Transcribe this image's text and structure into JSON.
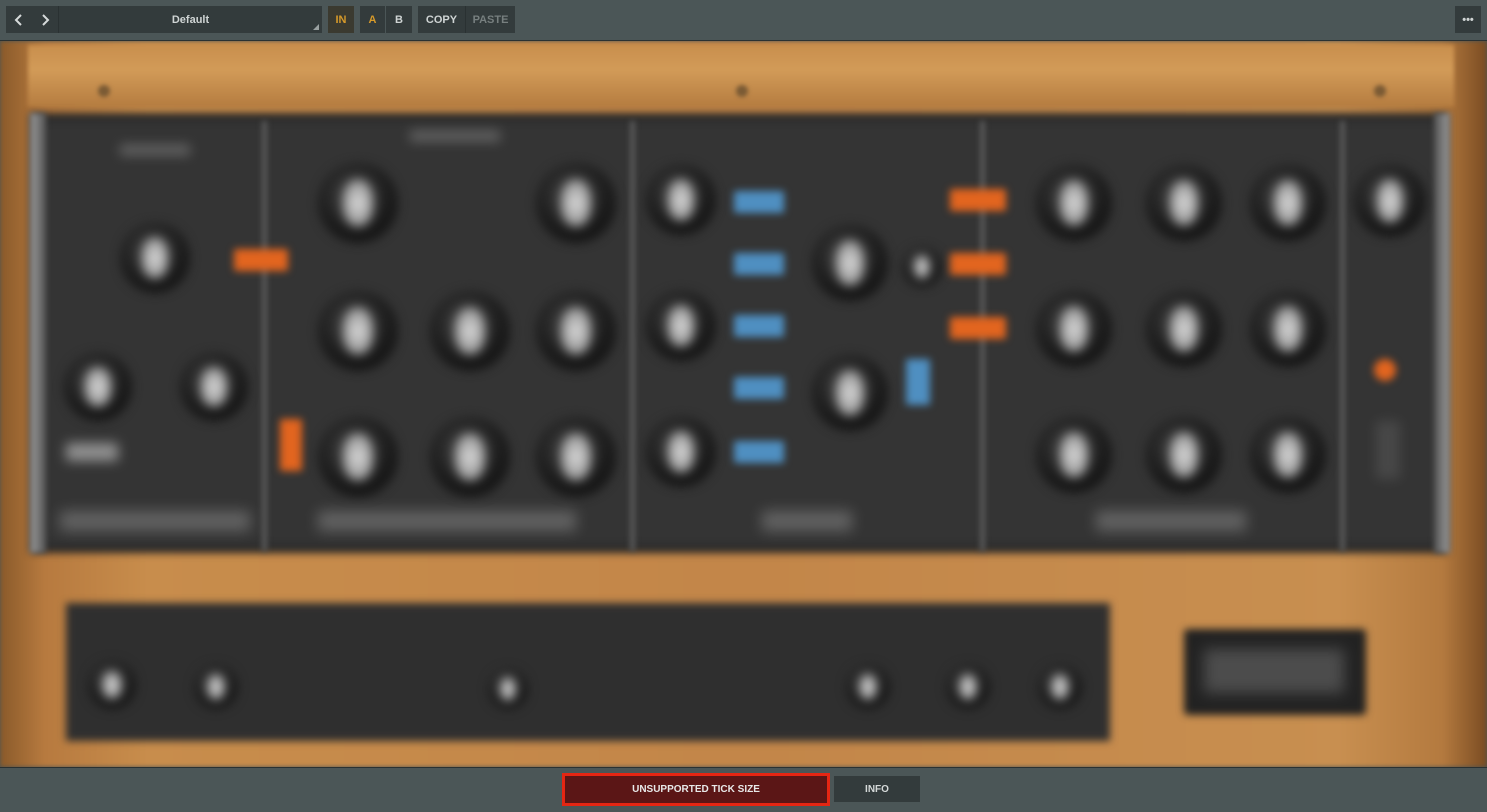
{
  "toolbar": {
    "prev_icon": "chevron-left-icon",
    "next_icon": "chevron-right-icon",
    "preset_name": "Default",
    "in_label": "IN",
    "a_label": "A",
    "b_label": "B",
    "copy_label": "COPY",
    "paste_label": "PASTE",
    "more_label": "•••"
  },
  "plugin": {
    "image_state": "blurred",
    "section_count": 4
  },
  "statusbar": {
    "warning_label": "UNSUPPORTED TICK SIZE",
    "info_label": "INFO"
  },
  "colors": {
    "accent_orange": "#d79a2a",
    "warning_border": "#e52613",
    "warning_bg": "#5b1616",
    "switch_blue": "#4f8fc1",
    "switch_orange": "#e2651f"
  }
}
